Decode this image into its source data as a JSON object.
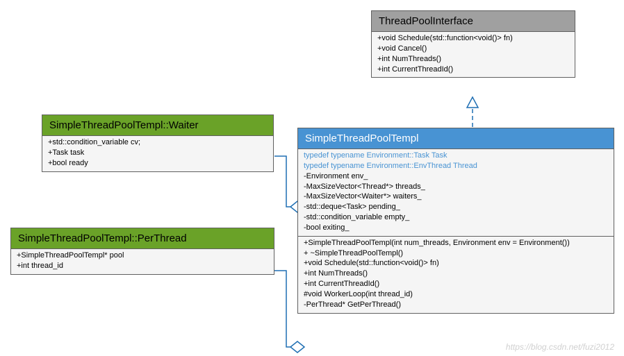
{
  "watermark": "https://blog.csdn.net/fuzi2012",
  "threadPoolInterface": {
    "title": "ThreadPoolInterface",
    "m0": "+void Schedule(std::function<void()> fn)",
    "m1": "+void Cancel()",
    "m2": "+int NumThreads()",
    "m3": "+int CurrentThreadId()"
  },
  "waiter": {
    "title": "SimpleThreadPoolTempl::Waiter",
    "m0": "+std::condition_variable cv;",
    "m1": "+Task task",
    "m2": "+bool ready"
  },
  "perThread": {
    "title": "SimpleThreadPoolTempl::PerThread",
    "m0": "+SimpleThreadPoolTempl* pool",
    "m1": "+int thread_id"
  },
  "simpleThreadPoolTempl": {
    "title": "SimpleThreadPoolTempl",
    "t0": "typedef typename Environment::Task Task",
    "t1": "typedef typename Environment::EnvThread Thread",
    "a0": "-Environment env_",
    "a1": "-MaxSizeVector<Thread*> threads_",
    "a2": "-MaxSizeVector<Waiter*> waiters_",
    "a3": "-std::deque<Task> pending_",
    "a4": "-std::condition_variable empty_",
    "a5": "-bool exiting_",
    "o0": "+SimpleThreadPoolTempl(int num_threads, Environment env = Environment())",
    "o1": "+ ~SimpleThreadPoolTempl()",
    "o2": "+void Schedule(std::function<void()> fn)",
    "o3": "+int NumThreads()",
    "o4": "+int CurrentThreadId()",
    "o5": "#void WorkerLoop(int thread_id)",
    "o6": "-PerThread* GetPerThread()"
  }
}
